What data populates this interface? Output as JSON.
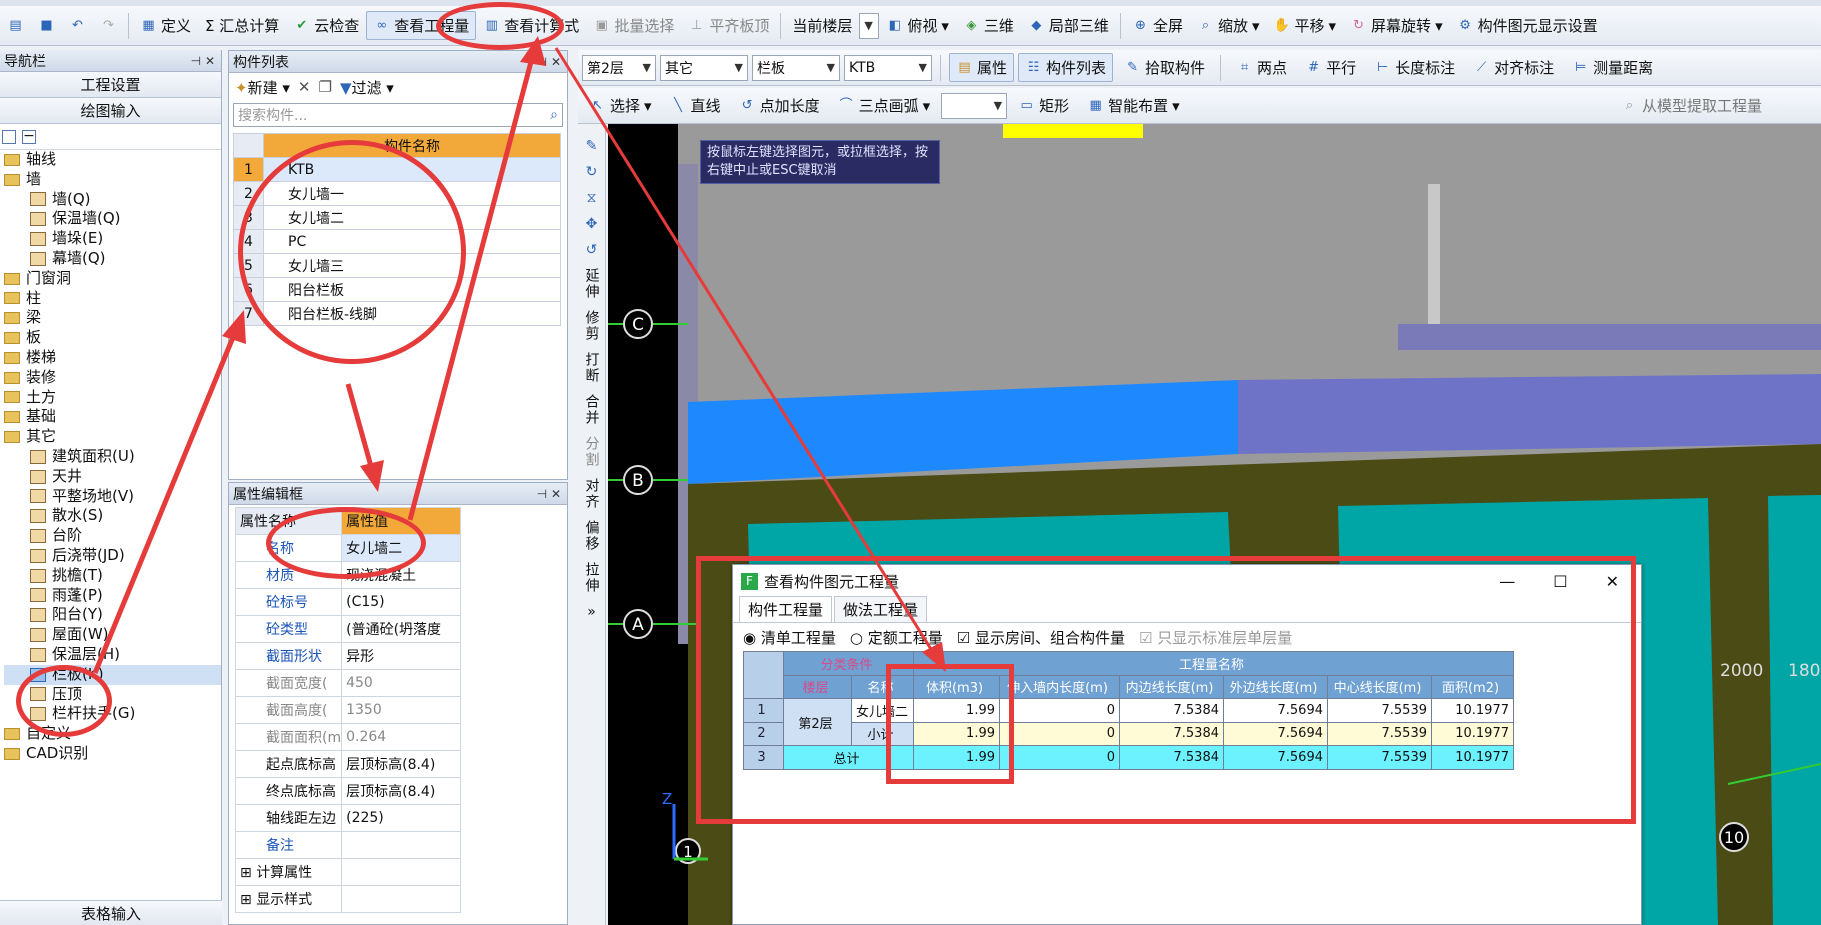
{
  "toolbar": {
    "items": [
      "定义",
      "Σ 汇总计算",
      "云检查",
      "查看工程量",
      "查看计算式",
      "批量选择",
      "平齐板顶",
      "当前楼层",
      "俯视",
      "三维",
      "局部三维",
      "全屏",
      "缩放",
      "平移",
      "屏幕旋转",
      "构件图元显示设置"
    ]
  },
  "nav": {
    "title": "导航栏",
    "btn_settings": "工程设置",
    "btn_draw": "绘图输入",
    "bottom_btn": "表格输入",
    "tree": [
      "轴线",
      "墙",
      "墙(Q)",
      "保温墙(Q)",
      "墙垛(E)",
      "幕墙(Q)",
      "门窗洞",
      "柱",
      "梁",
      "板",
      "楼梯",
      "装修",
      "土方",
      "基础",
      "其它",
      "建筑面积(U)",
      "天井",
      "平整场地(V)",
      "散水(S)",
      "台阶",
      "后浇带(JD)",
      "挑檐(T)",
      "雨蓬(P)",
      "阳台(Y)",
      "屋面(W)",
      "保温层(H)",
      "栏板(K)",
      "压顶",
      "栏杆扶手(G)",
      "自定义",
      "CAD识别"
    ]
  },
  "complist": {
    "title": "构件列表",
    "new_label": "新建",
    "filter_label": "过滤",
    "search_placeholder": "搜索构件...",
    "col_name": "构件名称",
    "rows": [
      "KTB",
      "女儿墙一",
      "女儿墙二",
      "PC",
      "女儿墙三",
      "阳台栏板",
      "阳台栏板-线脚"
    ]
  },
  "props": {
    "title": "属性编辑框",
    "col_name": "属性名称",
    "col_value": "属性值",
    "rows": [
      {
        "k": "名称",
        "v": "女儿墙二"
      },
      {
        "k": "材质",
        "v": "现浇混凝土"
      },
      {
        "k": "砼标号",
        "v": "(C15)"
      },
      {
        "k": "砼类型",
        "v": "(普通砼(坍落度"
      },
      {
        "k": "截面形状",
        "v": "异形"
      },
      {
        "k": "截面宽度(",
        "v": "450"
      },
      {
        "k": "截面高度(",
        "v": "1350"
      },
      {
        "k": "截面面积(m",
        "v": "0.264"
      },
      {
        "k": "起点底标高",
        "v": "层顶标高(8.4)"
      },
      {
        "k": "终点底标高",
        "v": "层顶标高(8.4)"
      },
      {
        "k": "轴线距左边",
        "v": "(225)"
      },
      {
        "k": "备注",
        "v": ""
      },
      {
        "k": "计算属性",
        "v": ""
      },
      {
        "k": "显示样式",
        "v": ""
      }
    ]
  },
  "toolbar2": {
    "floor": "第2层",
    "type": "其它",
    "sub": "栏板",
    "comp": "KTB",
    "btn_attr": "属性",
    "btn_list": "构件列表",
    "btn_pick": "拾取构件",
    "btn_twopt": "两点",
    "btn_parallel": "平行",
    "btn_len": "长度标注",
    "btn_align": "对齐标注",
    "btn_measure": "测量距离"
  },
  "toolbar3": {
    "select": "选择",
    "line": "直线",
    "addlen": "点加长度",
    "arc": "三点画弧",
    "rect": "矩形",
    "smart": "智能布置",
    "extract": "从模型提取工程量"
  },
  "vtools": [
    "延伸",
    "修剪",
    "打断",
    "合并",
    "分割",
    "对齐",
    "偏移",
    "拉伸"
  ],
  "viewport": {
    "hint": "按鼠标左键选择图元，或拉框选择，按右键中止或ESC键取消",
    "axis_c": "C",
    "axis_b": "B",
    "axis_a": "A",
    "axis_1": "1",
    "axis_10": "10",
    "dim_2000": "2000",
    "dim_180": "180",
    "axis_z": "Z"
  },
  "dialog": {
    "title": "查看构件图元工程量",
    "tab1": "构件工程量",
    "tab2": "做法工程量",
    "opt1": "清单工程量",
    "opt2": "定额工程量",
    "opt3": "显示房间、组合构件量",
    "opt4": "只显示标准层单层量",
    "h_cond": "分类条件",
    "h_qty": "工程量名称",
    "h_floor": "楼层",
    "h_name": "名称",
    "cols": [
      "体积(m3)",
      "伸入墙内长度(m)",
      "内边线长度(m)",
      "外边线长度(m)",
      "中心线长度(m)",
      "面积(m2)"
    ],
    "floor_val": "第2层",
    "name_val": "女儿墙二",
    "subtotal": "小计",
    "total": "总计",
    "rows": [
      [
        "1.99",
        "0",
        "7.5384",
        "7.5694",
        "7.5539",
        "10.1977"
      ],
      [
        "1.99",
        "0",
        "7.5384",
        "7.5694",
        "7.5539",
        "10.1977"
      ],
      [
        "1.99",
        "0",
        "7.5384",
        "7.5694",
        "7.5539",
        "10.1977"
      ]
    ]
  }
}
